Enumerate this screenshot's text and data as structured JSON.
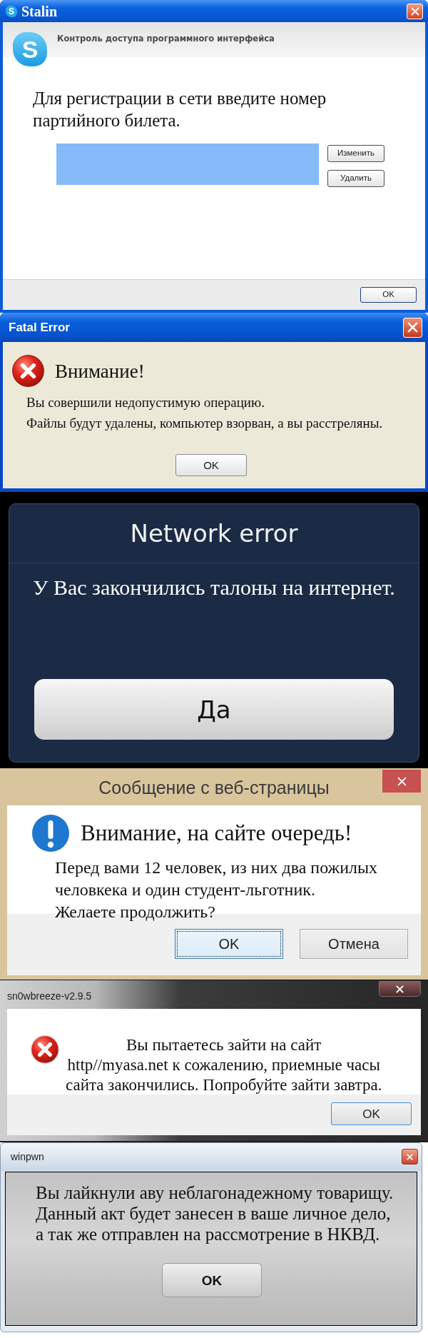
{
  "dialogs": [
    {
      "kind": "skype",
      "title_logo": "S",
      "title": "Stalin",
      "logo": "S",
      "header": "Контроль доступа программного интерфейса",
      "message": "Для регистрации в сети введите номер\nпартийного билета.",
      "side_buttons": [
        "Изменить",
        "Удалить"
      ],
      "buttons": [
        "OK"
      ]
    },
    {
      "kind": "xp_error",
      "title": "Fatal Error",
      "heading": "Внимание!",
      "message": "Вы совершили недопустимую операцию.\nФайлы будут удалены, компьютер взорван, а вы расстреляны.",
      "buttons": [
        "OK"
      ]
    },
    {
      "kind": "android",
      "title": "Network error",
      "message": "У Вас закончились талоны на интернет.",
      "buttons": [
        "Да"
      ]
    },
    {
      "kind": "win8",
      "title": "Сообщение с веб-страницы",
      "heading": "Внимание, на сайте очередь!",
      "message": "Перед вами 12 человек, из них два пожилых\nчеловкека и один студент-льготник.\nЖелаете продолжить?",
      "buttons": [
        {
          "label": "OK",
          "focused": true
        },
        {
          "label": "Отмена",
          "focused": false
        }
      ]
    },
    {
      "kind": "win7_error",
      "title": "sn0wbreeze-v2.9.5",
      "message": "Вы пытаетесь зайти на сайт\nhttp//myasa.net к сожалению, приемные часы\nсайта закончились. Попробуйте зайти завтра.",
      "buttons": [
        "OK"
      ]
    },
    {
      "kind": "win7_metal",
      "title": "winpwn",
      "message": "Вы лайкнули аву неблагонадежному товарищу.\nДанный акт будет занесен в ваше личное дело,\nа так же отправлен на рассмотрение в НКВД.",
      "buttons": [
        "OK"
      ]
    }
  ]
}
